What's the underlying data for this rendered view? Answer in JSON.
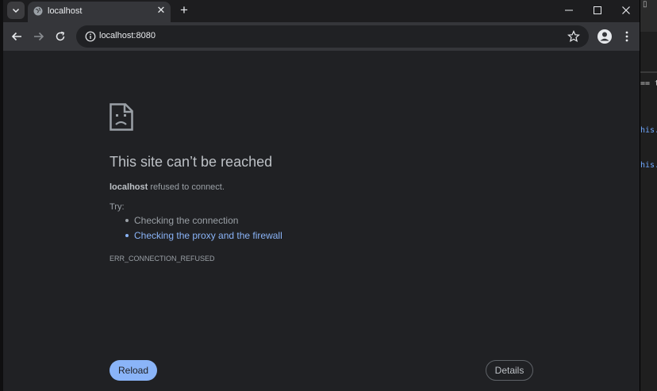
{
  "colors": {
    "accent": "#8ab4f8",
    "page_bg": "#202124",
    "toolbar_bg": "#35363a"
  },
  "tab": {
    "title": "localhost",
    "icon": "globe-icon",
    "close_label": "✕"
  },
  "newtab_label": "+",
  "toolbar": {
    "url": "localhost:8080",
    "back_icon": "back-arrow-icon",
    "forward_icon": "forward-arrow-icon",
    "reload_icon": "reload-icon",
    "info_icon": "site-info-icon",
    "bookmark_icon": "star-icon",
    "profile_icon": "profile-icon",
    "menu_icon": "kebab-menu-icon"
  },
  "error_page": {
    "heading": "This site can’t be reached",
    "host": "localhost",
    "summary_suffix": " refused to connect.",
    "try_label": "Try:",
    "suggestions": [
      "Checking the connection",
      "Checking the proxy and the firewall"
    ],
    "error_code": "ERR_CONNECTION_REFUSED",
    "reload_label": "Reload",
    "details_label": "Details"
  },
  "background_editor": {
    "line1": "== t",
    "line2": "his.",
    "line3": "his."
  }
}
